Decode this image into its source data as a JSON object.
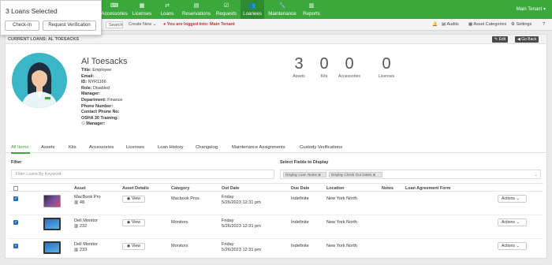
{
  "popup": {
    "title": "3 Loans Selected",
    "check_in": "Check-In",
    "request_verification": "Request Verification"
  },
  "nav": {
    "items": [
      {
        "label": "Accessories",
        "icon": "accessories-icon"
      },
      {
        "label": "Licenses",
        "icon": "licenses-icon"
      },
      {
        "label": "Loans",
        "icon": "loans-icon"
      },
      {
        "label": "Reservations",
        "icon": "calendar-icon"
      },
      {
        "label": "Requests",
        "icon": "requests-icon"
      },
      {
        "label": "Loanees",
        "icon": "users-icon"
      },
      {
        "label": "Maintenance",
        "icon": "wrench-icon"
      },
      {
        "label": "Reports",
        "icon": "chart-icon"
      }
    ],
    "tenant": "Main Tenant ▾"
  },
  "subbar": {
    "search": "Search",
    "create_new": "Create New",
    "warning": "You are logged into: Main Tenant",
    "audits": "Audits",
    "asset_categories": "Asset Categories",
    "settings": "Settings"
  },
  "card": {
    "title": "CURRENT LOANS: AL TOESACKS",
    "edit": "✎ Edit",
    "go_back": "◀ Go Back"
  },
  "profile": {
    "name": "Al Toesacks",
    "fields": [
      {
        "label": "Title:",
        "value": "Employee"
      },
      {
        "label": "Email:",
        "value": ""
      },
      {
        "label": "ID:",
        "value": "NYR1166"
      },
      {
        "label": "Role:",
        "value": "Disabled"
      },
      {
        "label": "Manager:",
        "value": ""
      },
      {
        "label": "Department:",
        "value": "Finance"
      },
      {
        "label": "Phone Number:",
        "value": ""
      },
      {
        "label": "Contact Phone No:",
        "value": ""
      },
      {
        "label": "OSHA 30 Training:",
        "value": ""
      },
      {
        "label": "Manager:",
        "value": ""
      }
    ]
  },
  "stats": [
    {
      "value": "3",
      "label": "Assets"
    },
    {
      "value": "0",
      "label": "Kits"
    },
    {
      "value": "0",
      "label": "Accessories"
    },
    {
      "value": "0",
      "label": "Licenses"
    }
  ],
  "tabs": [
    "All Items",
    "Assets",
    "Kits",
    "Accessories",
    "Licenses",
    "Loan History",
    "Changelog",
    "Maintenance Assignments",
    "Custody Verifications"
  ],
  "filter": {
    "label": "Filter",
    "placeholder": "Filter Loans By Keyword"
  },
  "fields_select": {
    "label": "Select Fields to Display",
    "chips": [
      "Display Loan Notes",
      "Display Check Out Dates"
    ]
  },
  "table": {
    "headers": [
      "Asset",
      "Asset Details",
      "Category",
      "Out Date",
      "Due Date",
      "Location",
      "Notes",
      "Loan Agreement Form"
    ],
    "view_label": "View",
    "actions_label": "Actions",
    "rows": [
      {
        "name": "MacBook Pro",
        "tag": "48",
        "category": "Macbook Pros",
        "out_day": "Friday",
        "out_date": "5/26/2023 12:31 pm",
        "due": "Indefinite",
        "location": "New York North"
      },
      {
        "name": "Dell Monitor",
        "tag": "232",
        "category": "Monitors",
        "out_day": "Friday",
        "out_date": "5/26/2023 12:31 pm",
        "due": "Indefinite",
        "location": "New York North"
      },
      {
        "name": "Dell Monitor",
        "tag": "233",
        "category": "Monitors",
        "out_day": "Friday",
        "out_date": "5/26/2023 12:31 pm",
        "due": "Indefinite",
        "location": "New York North"
      }
    ]
  },
  "colors": {
    "brand": "#3aa83a",
    "warning": "#c9302c",
    "checkbox": "#2a6ebb"
  }
}
